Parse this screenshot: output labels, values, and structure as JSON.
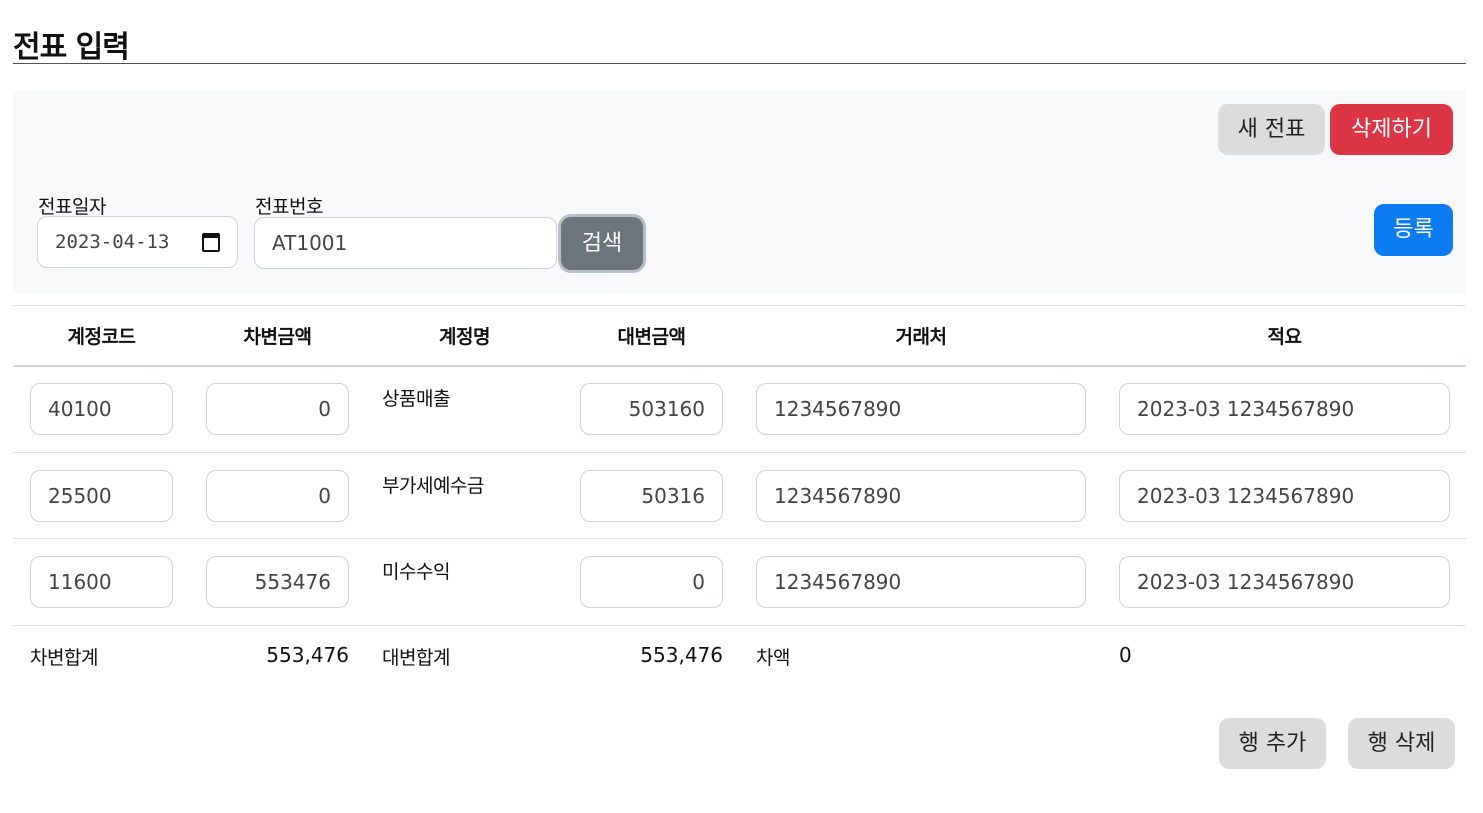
{
  "header": {
    "title": "전표 입력"
  },
  "toolbar": {
    "new_label": "새 전표",
    "delete_label": "삭제하기",
    "register_label": "등록",
    "search_label": "검색"
  },
  "form": {
    "date_label": "전표일자",
    "date_value": "2023-04-13",
    "number_label": "전표번호",
    "number_value": "AT1001"
  },
  "table": {
    "columns": [
      "계정코드",
      "차변금액",
      "계정명",
      "대변금액",
      "거래처",
      "적요"
    ],
    "rows": [
      {
        "code": "40100",
        "debit": "0",
        "name": "상품매출",
        "credit": "503160",
        "vendor": "1234567890",
        "memo": "2023-03 1234567890"
      },
      {
        "code": "25500",
        "debit": "0",
        "name": "부가세예수금",
        "credit": "50316",
        "vendor": "1234567890",
        "memo": "2023-03 1234567890"
      },
      {
        "code": "11600",
        "debit": "553476",
        "name": "미수수익",
        "credit": "0",
        "vendor": "1234567890",
        "memo": "2023-03 1234567890"
      }
    ]
  },
  "totals": {
    "debit_label": "차변합계",
    "debit_value": "553,476",
    "credit_label": "대변합계",
    "credit_value": "553,476",
    "diff_label": "차액",
    "diff_value": "0"
  },
  "row_actions": {
    "add_label": "행 추가",
    "delete_label": "행 삭제"
  },
  "colors": {
    "danger": "#dc3545",
    "primary": "#0d7cf2",
    "secondary": "#6c757d",
    "light": "#dcdcdc"
  }
}
